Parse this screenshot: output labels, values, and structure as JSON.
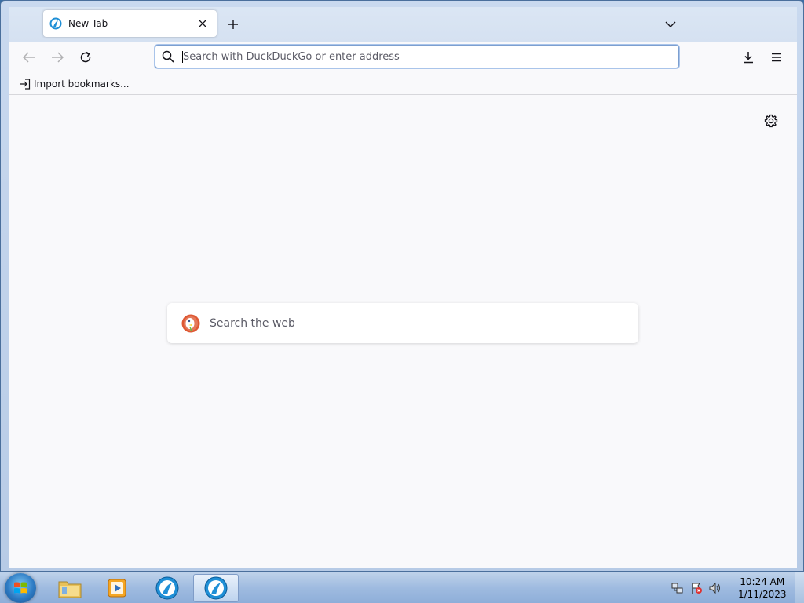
{
  "window": {
    "controls": {
      "minimize_icon": "minimize-icon",
      "maximize_icon": "restore-icon",
      "close_icon": "close-icon"
    }
  },
  "tabs": [
    {
      "title": "New Tab",
      "icon": "browser-favicon-icon"
    }
  ],
  "navbar": {
    "back_icon": "arrow-left-icon",
    "forward_icon": "arrow-right-icon",
    "reload_icon": "reload-icon",
    "url_placeholder": "Search with DuckDuckGo or enter address",
    "url_value": "",
    "downloads_icon": "download-icon",
    "menu_icon": "hamburger-menu-icon"
  },
  "bookmarks": {
    "items": [
      {
        "label": "Import bookmarks..."
      }
    ]
  },
  "content": {
    "search_placeholder": "Search the web",
    "engine_logo": "duckduckgo-logo-icon",
    "settings_icon": "gear-icon"
  },
  "taskbar": {
    "apps": [
      {
        "name": "explorer",
        "icon": "folder-icon",
        "active": false
      },
      {
        "name": "media-player",
        "icon": "media-player-icon",
        "active": false
      },
      {
        "name": "browser-1",
        "icon": "browser-icon",
        "active": false
      },
      {
        "name": "browser-2",
        "icon": "browser-icon",
        "active": true
      }
    ],
    "clock": {
      "time": "10:24 AM",
      "date": "1/11/2023"
    }
  },
  "colors": {
    "accent": "#0060df",
    "titlebar": "#c9d9ef",
    "taskbar": "#9fbbe0"
  }
}
